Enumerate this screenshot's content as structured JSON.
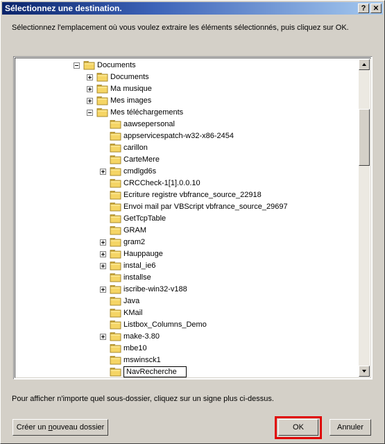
{
  "window": {
    "title": "Sélectionnez une destination.",
    "help_label": "?",
    "close_label": "X"
  },
  "instruction": "Sélectionnez l'emplacement où vous voulez extraire les éléments sélectionnés, puis cliquez sur OK.",
  "tree": {
    "nodes": [
      {
        "label": "Documents",
        "level": 0,
        "expander": "minus"
      },
      {
        "label": "Documents",
        "level": 1,
        "expander": "plus"
      },
      {
        "label": "Ma musique",
        "level": 1,
        "expander": "plus"
      },
      {
        "label": "Mes images",
        "level": 1,
        "expander": "plus"
      },
      {
        "label": "Mes téléchargements",
        "level": 1,
        "expander": "minus"
      },
      {
        "label": "aawsepersonal",
        "level": 2,
        "expander": "none"
      },
      {
        "label": "appservicespatch-w32-x86-2454",
        "level": 2,
        "expander": "none"
      },
      {
        "label": "carillon",
        "level": 2,
        "expander": "none"
      },
      {
        "label": "CarteMere",
        "level": 2,
        "expander": "none"
      },
      {
        "label": "cmdlgd6s",
        "level": 2,
        "expander": "plus"
      },
      {
        "label": "CRCCheck-1[1].0.0.10",
        "level": 2,
        "expander": "none"
      },
      {
        "label": "Ecriture registre vbfrance_source_22918",
        "level": 2,
        "expander": "none"
      },
      {
        "label": "Envoi mail par VBScript vbfrance_source_29697",
        "level": 2,
        "expander": "none"
      },
      {
        "label": "GetTcpTable",
        "level": 2,
        "expander": "none"
      },
      {
        "label": "GRAM",
        "level": 2,
        "expander": "none"
      },
      {
        "label": "gram2",
        "level": 2,
        "expander": "plus"
      },
      {
        "label": "Hauppauge",
        "level": 2,
        "expander": "plus"
      },
      {
        "label": "instal_ie6",
        "level": 2,
        "expander": "plus"
      },
      {
        "label": "installse",
        "level": 2,
        "expander": "none"
      },
      {
        "label": "iscribe-win32-v188",
        "level": 2,
        "expander": "plus"
      },
      {
        "label": "Java",
        "level": 2,
        "expander": "none"
      },
      {
        "label": "KMail",
        "level": 2,
        "expander": "none"
      },
      {
        "label": "Listbox_Columns_Demo",
        "level": 2,
        "expander": "none"
      },
      {
        "label": "make-3.80",
        "level": 2,
        "expander": "plus"
      },
      {
        "label": "mbe10",
        "level": 2,
        "expander": "none"
      },
      {
        "label": "mswinsck1",
        "level": 2,
        "expander": "none"
      },
      {
        "label": "NavRecherche",
        "level": 2,
        "expander": "none",
        "editing": true
      }
    ]
  },
  "hint": "Pour afficher n'importe quel sous-dossier, cliquez sur un signe plus ci-dessus.",
  "buttons": {
    "new_folder_prefix": "Créer un ",
    "new_folder_underlined": "n",
    "new_folder_suffix": "ouveau dossier",
    "ok": "OK",
    "cancel": "Annuler"
  },
  "colors": {
    "title_start": "#0a246a",
    "title_end": "#a6caf0",
    "highlight": "#e00000",
    "folder": "#f5d565"
  }
}
